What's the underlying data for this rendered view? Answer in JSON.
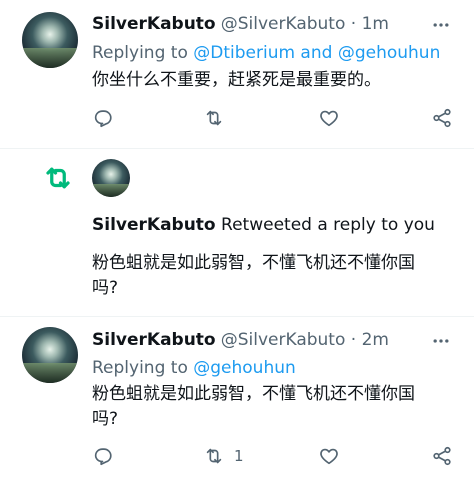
{
  "tweet1": {
    "name": "SilverKabuto",
    "handle_time": "@SilverKabuto · 1m",
    "replying_prefix": "Replying to ",
    "replying_to": "@Dtiberium and @gehouhun",
    "text": "你坐什么不重要，赶紧死是最重要的。",
    "reply_count": "",
    "retweet_count": "",
    "like_count": ""
  },
  "notification": {
    "name": "SilverKabuto",
    "action_text": " Retweeted a reply to you",
    "text_line1": "粉色蛆就是如此弱智，不懂飞机还不懂你国",
    "text_line2": "吗?"
  },
  "tweet2": {
    "name": "SilverKabuto",
    "handle_time": "@SilverKabuto · 2m",
    "replying_prefix": "Replying to ",
    "replying_to": "@gehouhun",
    "text_line1": "粉色蛆就是如此弱智，不懂飞机还不懂你国",
    "text_line2": "吗?",
    "retweet_count": "1"
  },
  "colors": {
    "text": "#0f1419",
    "secondary": "#536471",
    "link": "#1d9bf0",
    "retweet_green": "#00ba7c",
    "divider": "#eff3f4"
  },
  "icons": [
    "more-icon",
    "reply-icon",
    "retweet-icon",
    "like-icon",
    "share-icon"
  ]
}
